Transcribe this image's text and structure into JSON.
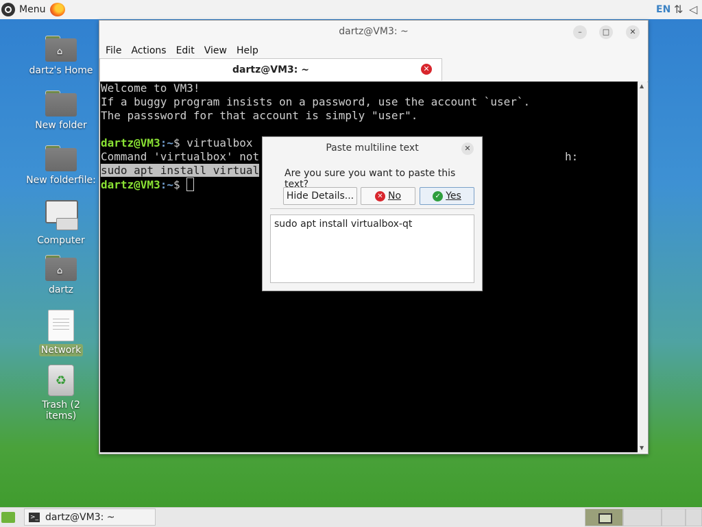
{
  "top_panel": {
    "menu_label": "Menu",
    "lang": "EN"
  },
  "desktop_icons": [
    {
      "label": "dartz's Home"
    },
    {
      "label": "New folder"
    },
    {
      "label": "New folderfile:"
    },
    {
      "label": "Computer"
    },
    {
      "label": "dartz"
    },
    {
      "label": "Network"
    },
    {
      "label": "Trash (2 items)"
    }
  ],
  "window": {
    "title": "dartz@VM3: ~",
    "menu": [
      "File",
      "Actions",
      "Edit",
      "View",
      "Help"
    ],
    "tab_label": "dartz@VM3: ~"
  },
  "terminal": {
    "line1": "Welcome to VM3!",
    "line2": "If a buggy program insists on a password, use the account `user`.",
    "line3": "The passsword for that account is simply \"user\".",
    "prompt_user": "dartz@VM3",
    "prompt_path": ":~",
    "prompt_sym": "$ ",
    "cmd1": "virtualbox",
    "line5_a": "Command 'virtualbox' not",
    "line5_b": "h:",
    "line6": "sudo apt install virtual"
  },
  "dialog": {
    "title": "Paste multiline text",
    "question": "Are you sure you want to paste this text?",
    "hide_details": "Hide Details...",
    "no": "No",
    "yes": "Yes",
    "paste_text": "sudo apt install virtualbox-qt"
  },
  "taskbar": {
    "task_label": "dartz@VM3: ~"
  }
}
